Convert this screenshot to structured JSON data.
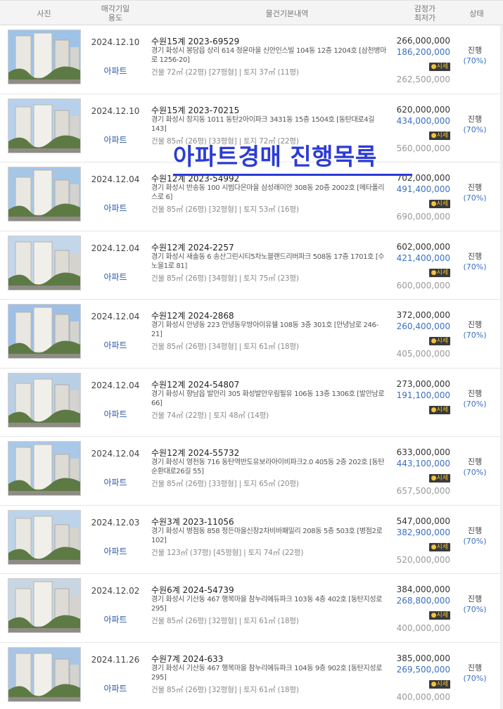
{
  "header": {
    "photo": "사진",
    "date_l1": "매각기일",
    "date_l2": "용도",
    "info": "물건기본내역",
    "price_l1": "감정가",
    "price_l2": "최저가",
    "status": "상태"
  },
  "overlay_title": "아파트경매 진행목록",
  "market_label": "시세",
  "rows": [
    {
      "date": "2024.12.10",
      "usage": "아파트",
      "case": "수원15계 2023-69529",
      "addr": "경기 화성시 봉담읍 상리 614 청운마을 신안인스빌 104동 12층 1204호 [삼천병마로 1256-20]",
      "area": "건물 72㎡ (22평) [27평형]  |  토지 37㎡ (11평)",
      "appraisal": "266,000,000",
      "minimum": "186,200,000",
      "market": "262,500,000",
      "status": "진행",
      "pct": "(70%)"
    },
    {
      "date": "2024.12.10",
      "usage": "아파트",
      "case": "수원15계 2023-70215",
      "addr": "경기 화성시 장지동 1011 동탄2아이파크 3431동 15층 1504호 [동탄대로4길 143]",
      "area": "건물 85㎡ (26평) [33평형]  |  토지 72㎡ (22평)",
      "appraisal": "620,000,000",
      "minimum": "434,000,000",
      "market": "560,000,000",
      "status": "진행",
      "pct": "(70%)"
    },
    {
      "date": "2024.12.04",
      "usage": "아파트",
      "case": "수원12계 2023-54992",
      "addr": "경기 화성시 반송동 100 시범다은마을 삼성래미안 308동 20층 2002호 [메타폴리스로 6]",
      "area": "건물 85㎡ (26평) [32평형]  |  토지 53㎡ (16평)",
      "appraisal": "702,000,000",
      "minimum": "491,400,000",
      "market": "690,000,000",
      "status": "진행",
      "pct": "(70%)"
    },
    {
      "date": "2024.12.04",
      "usage": "아파트",
      "case": "수원12계 2024-2257",
      "addr": "경기 화성시 새솔동 6 송산그린시티5차노블랜드리버파크 508동 17층 1701호 [수노을1로 81]",
      "area": "건물 85㎡ (26평) [34평형]  |  토지 75㎡ (23평)",
      "appraisal": "602,000,000",
      "minimum": "421,400,000",
      "market": "600,000,000",
      "status": "진행",
      "pct": "(70%)"
    },
    {
      "date": "2024.12.04",
      "usage": "아파트",
      "case": "수원12계 2024-2868",
      "addr": "경기 화성시 안녕동 223 안녕동우방아이유쉘 108동 3층 301호 [안녕남로 246-21]",
      "area": "건물 85㎡ (26평) [34평형]  |  토지 61㎡ (18평)",
      "appraisal": "372,000,000",
      "minimum": "260,400,000",
      "market": "405,000,000",
      "status": "진행",
      "pct": "(70%)"
    },
    {
      "date": "2024.12.04",
      "usage": "아파트",
      "case": "수원12계 2024-54807",
      "addr": "경기 화성시 향남읍 발안리 305 화성발안우림필유 106동 13층 1306호 [발안남로 66]",
      "area": "건물 74㎡ (22평)  |  토지 48㎡ (14평)",
      "appraisal": "273,000,000",
      "minimum": "191,100,000",
      "market": "",
      "status": "진행",
      "pct": "(70%)"
    },
    {
      "date": "2024.12.04",
      "usage": "아파트",
      "case": "수원12계 2024-55732",
      "addr": "경기 화성시 영천동 716 동탄역반도유보라아이비파크2.0 405동 2층 202호 [동탄순환대로26길 55]",
      "area": "건물 85㎡ (26평) [33평형]  |  토지 65㎡ (20평)",
      "appraisal": "633,000,000",
      "minimum": "443,100,000",
      "market": "657,500,000",
      "status": "진행",
      "pct": "(70%)"
    },
    {
      "date": "2024.12.03",
      "usage": "아파트",
      "case": "수원3계 2023-11056",
      "addr": "경기 화성시 병점동 858 정든마을신창2차비바패밀리 208동 5층 503호 [병점2로 102]",
      "area": "건물 123㎡ (37평) [45평형]  |  토지 74㎡ (22평)",
      "appraisal": "547,000,000",
      "minimum": "382,900,000",
      "market": "520,000,000",
      "status": "진행",
      "pct": "(70%)"
    },
    {
      "date": "2024.12.02",
      "usage": "아파트",
      "case": "수원6계 2024-54739",
      "addr": "경기 화성시 기산동 467 행복마을 참누리에듀파크 103동 4층 402호 [동탄지성로 295]",
      "area": "건물 85㎡ (26평) [32평형]  |  토지 61㎡ (18평)",
      "appraisal": "384,000,000",
      "minimum": "268,800,000",
      "market": "400,000,000",
      "status": "진행",
      "pct": "(70%)"
    },
    {
      "date": "2024.11.26",
      "usage": "아파트",
      "case": "수원7계 2024-633",
      "addr": "경기 화성시 기산동 467 행복마을 참누리에듀파크 104동 9층 902호 [동탄지성로 295]",
      "area": "건물 85㎡ (26평) [32평형]  |  토지 61㎡ (18평)",
      "appraisal": "385,000,000",
      "minimum": "269,500,000",
      "market": "400,000,000",
      "status": "진행",
      "pct": "(70%)"
    }
  ]
}
